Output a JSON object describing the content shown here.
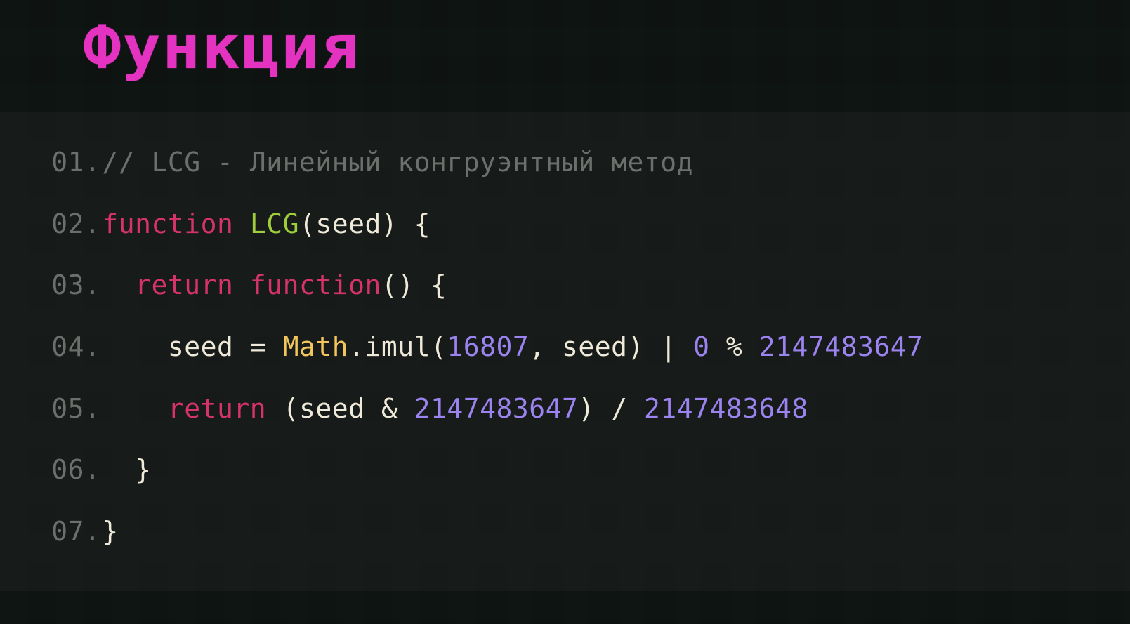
{
  "title": "Функция",
  "linenum_sep": ".",
  "code": {
    "lines": [
      {
        "num": "01",
        "tokens": [
          {
            "cls": "tk-comment",
            "text": "// LCG - Линейный конгруэнтный метод"
          }
        ]
      },
      {
        "num": "02",
        "tokens": [
          {
            "cls": "tk-keyword",
            "text": "function"
          },
          {
            "cls": "tk-plain",
            "text": " "
          },
          {
            "cls": "tk-func",
            "text": "LCG"
          },
          {
            "cls": "tk-punct",
            "text": "("
          },
          {
            "cls": "tk-plain",
            "text": "seed"
          },
          {
            "cls": "tk-punct",
            "text": ") {"
          }
        ]
      },
      {
        "num": "03",
        "tokens": [
          {
            "cls": "tk-plain",
            "text": "  "
          },
          {
            "cls": "tk-keyword",
            "text": "return"
          },
          {
            "cls": "tk-plain",
            "text": " "
          },
          {
            "cls": "tk-keyword",
            "text": "function"
          },
          {
            "cls": "tk-punct",
            "text": "() {"
          }
        ]
      },
      {
        "num": "04",
        "tokens": [
          {
            "cls": "tk-plain",
            "text": "    seed "
          },
          {
            "cls": "tk-punct",
            "text": "="
          },
          {
            "cls": "tk-plain",
            "text": " "
          },
          {
            "cls": "tk-class",
            "text": "Math"
          },
          {
            "cls": "tk-punct",
            "text": "."
          },
          {
            "cls": "tk-plain",
            "text": "imul"
          },
          {
            "cls": "tk-punct",
            "text": "("
          },
          {
            "cls": "tk-number",
            "text": "16807"
          },
          {
            "cls": "tk-punct",
            "text": ","
          },
          {
            "cls": "tk-plain",
            "text": " seed"
          },
          {
            "cls": "tk-punct",
            "text": ")"
          },
          {
            "cls": "tk-plain",
            "text": " "
          },
          {
            "cls": "tk-punct",
            "text": "|"
          },
          {
            "cls": "tk-plain",
            "text": " "
          },
          {
            "cls": "tk-number",
            "text": "0"
          },
          {
            "cls": "tk-plain",
            "text": " "
          },
          {
            "cls": "tk-punct",
            "text": "%"
          },
          {
            "cls": "tk-plain",
            "text": " "
          },
          {
            "cls": "tk-number",
            "text": "2147483647"
          }
        ]
      },
      {
        "num": "05",
        "tokens": [
          {
            "cls": "tk-plain",
            "text": "    "
          },
          {
            "cls": "tk-keyword",
            "text": "return"
          },
          {
            "cls": "tk-plain",
            "text": " "
          },
          {
            "cls": "tk-punct",
            "text": "("
          },
          {
            "cls": "tk-plain",
            "text": "seed "
          },
          {
            "cls": "tk-punct",
            "text": "&"
          },
          {
            "cls": "tk-plain",
            "text": " "
          },
          {
            "cls": "tk-number",
            "text": "2147483647"
          },
          {
            "cls": "tk-punct",
            "text": ")"
          },
          {
            "cls": "tk-plain",
            "text": " "
          },
          {
            "cls": "tk-punct",
            "text": "/"
          },
          {
            "cls": "tk-plain",
            "text": " "
          },
          {
            "cls": "tk-number",
            "text": "2147483648"
          }
        ]
      },
      {
        "num": "06",
        "tokens": [
          {
            "cls": "tk-punct",
            "text": "  }"
          }
        ]
      },
      {
        "num": "07",
        "tokens": [
          {
            "cls": "tk-punct",
            "text": "}"
          }
        ]
      }
    ]
  }
}
